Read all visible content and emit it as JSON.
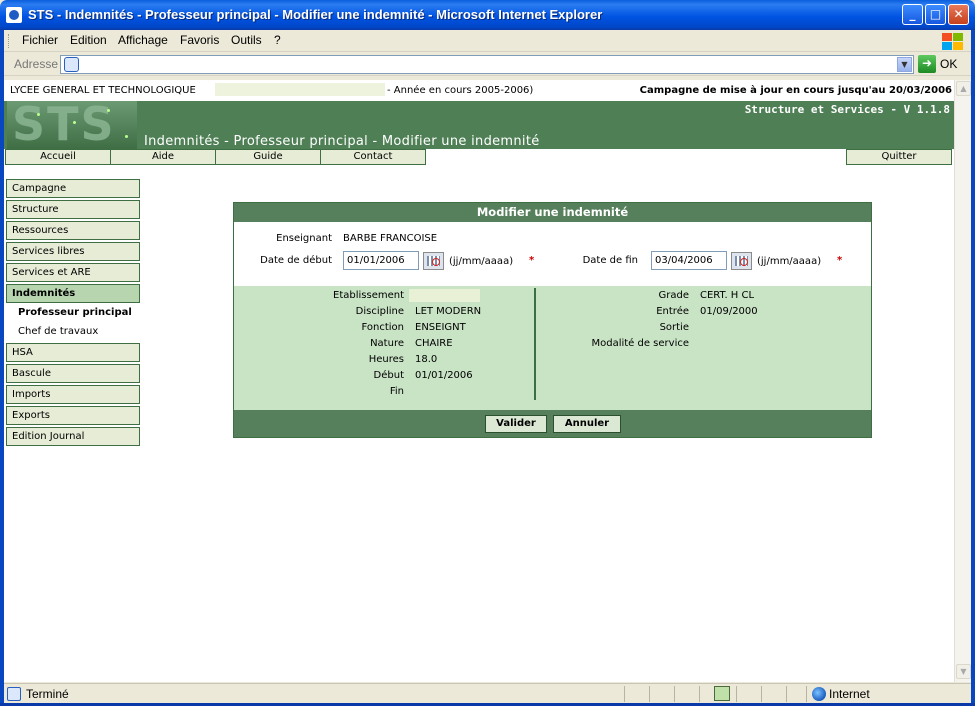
{
  "window": {
    "title": "STS - Indemnités - Professeur principal - Modifier une indemnité - Microsoft Internet Explorer",
    "minimize": "_",
    "maximize": "□",
    "close": "✕"
  },
  "menu": [
    "Fichier",
    "Edition",
    "Affichage",
    "Favoris",
    "Outils",
    "?"
  ],
  "address": {
    "label": "Adresse",
    "value": "",
    "go_label": "OK"
  },
  "header": {
    "school": "LYCEE GENERAL ET TECHNOLOGIQUE",
    "year": "- Année en cours 2005-2006)",
    "campaign": "Campagne de mise à jour en cours jusqu'au 20/03/2006",
    "product": "Structure et Services - V 1.1.8",
    "page_title": "Indemnités - Professeur principal - Modifier une indemnité",
    "logo_text": "STS"
  },
  "nav": {
    "accueil": "Accueil",
    "aide": "Aide",
    "guide": "Guide",
    "contact": "Contact",
    "quitter": "Quitter"
  },
  "sidebar": {
    "campagne": "Campagne",
    "structure": "Structure",
    "ressources": "Ressources",
    "services_libres": "Services libres",
    "services_are": "Services et ARE",
    "indemnites": "Indemnités",
    "prof_principal": "Professeur principal",
    "chef_travaux": "Chef de travaux",
    "hsa": "HSA",
    "bascule": "Bascule",
    "imports": "Imports",
    "exports": "Exports",
    "edition_journal": "Edition Journal"
  },
  "form": {
    "heading": "Modifier une indemnité",
    "enseignant_label": "Enseignant",
    "enseignant_value": "BARBE FRANCOISE",
    "date_debut_label": "Date de début",
    "date_debut_value": "01/01/2006",
    "date_fin_label": "Date de fin",
    "date_fin_value": "03/04/2006",
    "date_format": "(jj/mm/aaaa)",
    "required_mark": "*",
    "info_left": {
      "etablissement_label": "Etablissement",
      "etablissement_value": "",
      "discipline_label": "Discipline",
      "discipline_value": "LET MODERN",
      "fonction_label": "Fonction",
      "fonction_value": "ENSEIGNT",
      "nature_label": "Nature",
      "nature_value": "CHAIRE",
      "heures_label": "Heures",
      "heures_value": "18.0",
      "debut_label": "Début",
      "debut_value": "01/01/2006",
      "fin_label": "Fin",
      "fin_value": ""
    },
    "info_right": {
      "grade_label": "Grade",
      "grade_value": "CERT. H CL",
      "entree_label": "Entrée",
      "entree_value": "01/09/2000",
      "sortie_label": "Sortie",
      "sortie_value": "",
      "modalite_label": "Modalité de service",
      "modalite_value": ""
    },
    "valider": "Valider",
    "annuler": "Annuler"
  },
  "status": {
    "text": "Terminé",
    "zone": "Internet"
  }
}
